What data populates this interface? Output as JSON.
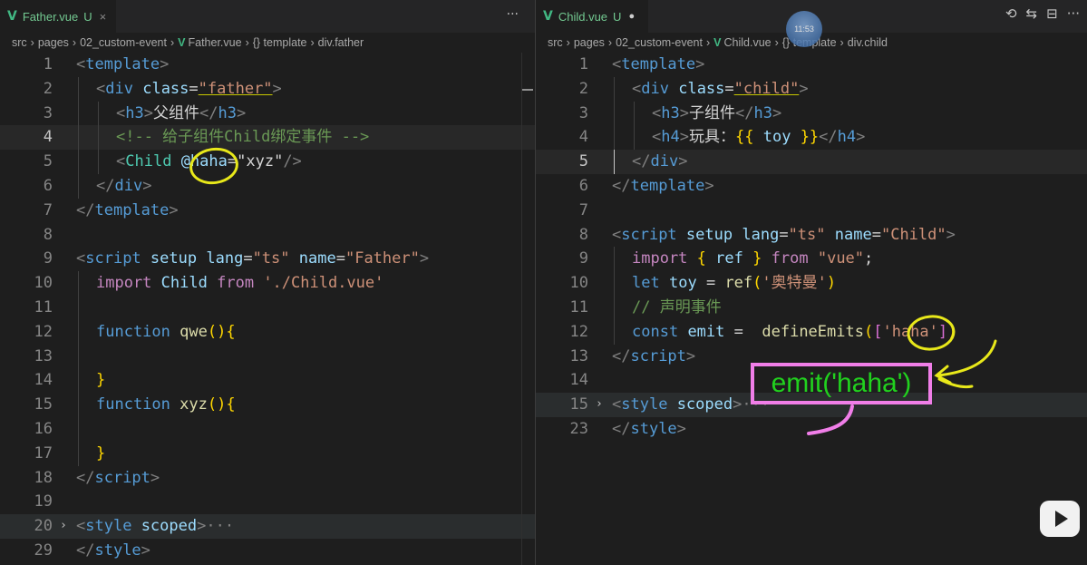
{
  "left_editor": {
    "tab": {
      "name": "Father.vue",
      "status": "U",
      "close": "×"
    },
    "more": "···",
    "breadcrumb": [
      "src",
      "pages",
      "02_custom-event",
      "Father.vue",
      "{} template",
      "div.father"
    ],
    "lines": [
      {
        "n": "1"
      },
      {
        "n": "2"
      },
      {
        "n": "3"
      },
      {
        "n": "4"
      },
      {
        "n": "5"
      },
      {
        "n": "6"
      },
      {
        "n": "7"
      },
      {
        "n": "8"
      },
      {
        "n": "9"
      },
      {
        "n": "10"
      },
      {
        "n": "11"
      },
      {
        "n": "12"
      },
      {
        "n": "13"
      },
      {
        "n": "14"
      },
      {
        "n": "15"
      },
      {
        "n": "16"
      },
      {
        "n": "17"
      },
      {
        "n": "18"
      },
      {
        "n": "19"
      },
      {
        "n": "20"
      },
      {
        "n": "29"
      }
    ],
    "code": {
      "l1": "template",
      "l2_tag": "div",
      "l2_attr": "class",
      "l2_val": "\"father\"",
      "l3_tag": "h3",
      "l3_text": "父组件",
      "l4_comment": "<!-- 给子组件Child绑定事件 -->",
      "l5_tag": "Child",
      "l5_event": "@haha",
      "l5_val": "\"xyz\"",
      "l6_tag": "div",
      "l7_tag": "template",
      "l9_tag": "script",
      "l9_a1": "setup",
      "l9_a2": "lang",
      "l9_v2": "\"ts\"",
      "l9_a3": "name",
      "l9_v3": "\"Father\"",
      "l10_kw": "import",
      "l10_id": "Child",
      "l10_from": "from",
      "l10_path": "'./Child.vue'",
      "l12_kw": "function",
      "l12_fn": "qwe",
      "l14_brace": "}",
      "l15_kw": "function",
      "l15_fn": "xyz",
      "l17_brace": "}",
      "l18_tag": "script",
      "l20_tag": "style",
      "l20_attr": "scoped",
      "l20_ellipsis": "···",
      "l29_tag": "style"
    }
  },
  "right_editor": {
    "tab": {
      "name": "Child.vue",
      "status": "U",
      "dirty": "●"
    },
    "clock": "11:53",
    "actions": [
      "⟲",
      "⇆",
      "⊟",
      "···"
    ],
    "breadcrumb": [
      "src",
      "pages",
      "02_custom-event",
      "Child.vue",
      "{} template",
      "div.child"
    ],
    "lines": [
      {
        "n": "1"
      },
      {
        "n": "2"
      },
      {
        "n": "3"
      },
      {
        "n": "4"
      },
      {
        "n": "5"
      },
      {
        "n": "6"
      },
      {
        "n": "7"
      },
      {
        "n": "8"
      },
      {
        "n": "9"
      },
      {
        "n": "10"
      },
      {
        "n": "11"
      },
      {
        "n": "12"
      },
      {
        "n": "13"
      },
      {
        "n": "14"
      },
      {
        "n": "15"
      },
      {
        "n": "23"
      }
    ],
    "code": {
      "l1": "template",
      "l2_tag": "div",
      "l2_attr": "class",
      "l2_val": "\"child\"",
      "l3_tag": "h3",
      "l3_text": "子组件",
      "l4_tag": "h4",
      "l4_text": "玩具：",
      "l4_expr": "toy",
      "l5_tag": "div",
      "l6_tag": "template",
      "l8_tag": "script",
      "l8_a1": "setup",
      "l8_a2": "lang",
      "l8_v2": "\"ts\"",
      "l8_a3": "name",
      "l8_v3": "\"Child\"",
      "l9_kw": "import",
      "l9_id": "ref",
      "l9_from": "from",
      "l9_path": "\"vue\"",
      "l10_kw": "let",
      "l10_id": "toy",
      "l10_fn": "ref",
      "l10_arg": "'奥特曼'",
      "l11_comment": "// 声明事件",
      "l12_kw": "const",
      "l12_id": "emit",
      "l12_fn": "defineEmits",
      "l12_arg": "'haha'",
      "l13_tag": "script",
      "l15_tag": "style",
      "l15_attr": "scoped",
      "l15_ellipsis": "···",
      "l23_tag": "style"
    }
  },
  "annotation": {
    "text": "emit('haha')"
  },
  "colors": {
    "vue_green": "#41b883",
    "untracked": "#73c991",
    "annotation_pink": "#f07ee8",
    "annotation_yellow": "#e8e81a",
    "annotation_text": "#21d11e"
  },
  "icons": [
    "vue-icon",
    "close-icon",
    "more-icon",
    "history-icon",
    "compare-icon",
    "split-editor-icon",
    "fold-chevron-icon",
    "bilibili-play-icon"
  ]
}
